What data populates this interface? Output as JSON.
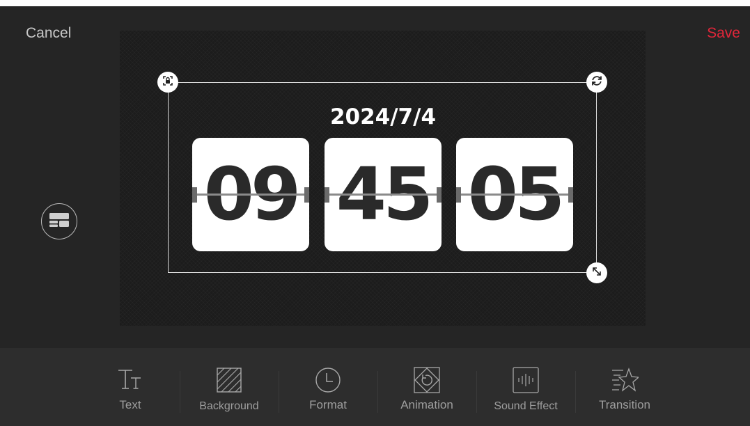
{
  "header": {
    "cancel_label": "Cancel",
    "save_label": "Save"
  },
  "colors": {
    "accent": "#e2263a",
    "background": "#252525",
    "toolbar": "#2d2d2d",
    "card": "#ffffff"
  },
  "clock": {
    "date": "2024/7/4",
    "hours": "09",
    "minutes": "45",
    "seconds": "05"
  },
  "handles": [
    "lock-icon",
    "rotate-icon",
    "resize-icon"
  ],
  "side": {
    "layout_icon": "layout-icon"
  },
  "toolbar": {
    "items": [
      {
        "label": "Text",
        "icon": "text-size-icon"
      },
      {
        "label": "Background",
        "icon": "background-pattern-icon"
      },
      {
        "label": "Format",
        "icon": "clock-icon"
      },
      {
        "label": "Animation",
        "icon": "animation-icon"
      },
      {
        "label": "Sound Effect",
        "icon": "sound-wave-icon"
      },
      {
        "label": "Transition",
        "icon": "star-transition-icon"
      }
    ]
  }
}
